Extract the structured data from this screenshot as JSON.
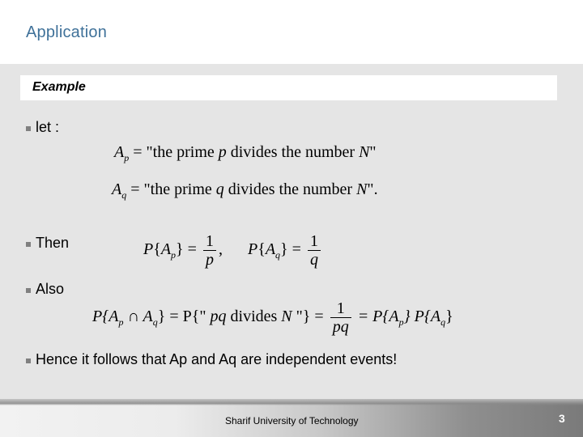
{
  "slide": {
    "title": "Application",
    "section_label": "Example",
    "bullets": [
      {
        "text": "let :"
      },
      {
        "text": "Then"
      },
      {
        "text": "Also"
      },
      {
        "text": "Hence it follows that Ap and Aq are independent events!"
      }
    ],
    "equations": {
      "def_ap": {
        "lhs": "A",
        "sub": "p",
        "rhs_pre": " = \"the prime ",
        "var": "p",
        "rhs_post": " divides the number ",
        "N": "N",
        "end": "\""
      },
      "def_aq": {
        "lhs": "A",
        "sub": "q",
        "rhs_pre": " = \"the prime ",
        "var": "q",
        "rhs_post": " divides the number ",
        "N": "N",
        "end": "\"."
      },
      "prob_ap": {
        "P": "P",
        "open": "{",
        "A": "A",
        "sub": "p",
        "close": "}",
        "eq": " = ",
        "num": "1",
        "den": "p",
        "sep": ","
      },
      "prob_aq": {
        "P": "P",
        "open": "{",
        "A": "A",
        "sub": "q",
        "close": "}",
        "eq": " = ",
        "num": "1",
        "den": "q"
      },
      "joint": {
        "lhs": "P{A",
        "sub1": "p",
        "cap": " ∩ A",
        "sub2": "q",
        "mid": "} = P{\" ",
        "pq": "pq",
        "divides": " divides ",
        "N": "N",
        "mid2": " \"} = ",
        "num": "1",
        "den": "pq",
        "rhs1": " = P{A",
        "sub3": "p",
        "rhs2": "} P{A",
        "sub4": "q",
        "rhs3": "}"
      }
    },
    "footer": {
      "institution": "Sharif University of Technology",
      "page_number": "3"
    }
  },
  "colors": {
    "title": "#3f7199",
    "content_bg": "#e5e5e5",
    "bullet_square": "#808080"
  }
}
